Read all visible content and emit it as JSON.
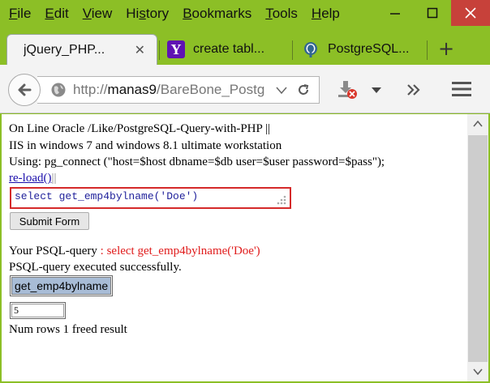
{
  "menu": {
    "items": [
      {
        "underline": "F",
        "rest": "ile"
      },
      {
        "underline": "E",
        "rest": "dit"
      },
      {
        "underline": "V",
        "rest": "iew"
      },
      {
        "underline": "",
        "pre": "Hi",
        "u2": "s",
        "rest": "tory"
      },
      {
        "underline": "B",
        "rest": "ookmarks"
      },
      {
        "underline": "T",
        "rest": "ools"
      },
      {
        "underline": "H",
        "rest": "elp"
      }
    ]
  },
  "tabs": [
    {
      "label": "jQuery_PHP...",
      "icon": "none",
      "active": true
    },
    {
      "label": "create tabl...",
      "icon": "yahoo-icon",
      "active": false
    },
    {
      "label": "PostgreSQL...",
      "icon": "postgresql-elephant-icon",
      "active": false
    }
  ],
  "url": {
    "prefix": "http://",
    "host": "manas9",
    "path": "/BareBone_Postg"
  },
  "page": {
    "line1": "On Line Oracle /Like/PostgreSQL-Query-with-PHP ||",
    "line2": "IIS in windows 7 and windows 8.1 ultimate workstation",
    "line3": "Using: pg_connect (\"host=$host dbname=$db user=$user password=$pass\");",
    "reload_link": "re-load()",
    "reload_sep": "||",
    "query_text": "select get_emp4bylname('Doe')",
    "submit_label": "Submit Form",
    "your_query_label": "Your PSQL-query ",
    "your_query_value": ": select get_emp4bylname('Doe')",
    "executed_msg": "PSQL-query executed successfully.",
    "result_header": "get_emp4bylname",
    "result_value": "5",
    "num_rows_msg": "Num rows 1 freed result"
  },
  "colors": {
    "frame": "#8cbf26",
    "close_button": "#c7413a",
    "query_border": "#d52a2a",
    "query_text": "#1f1f9a",
    "highlight_red": "#e01b1b",
    "table_header": "#a8bcd6",
    "link": "#1a0dab"
  }
}
